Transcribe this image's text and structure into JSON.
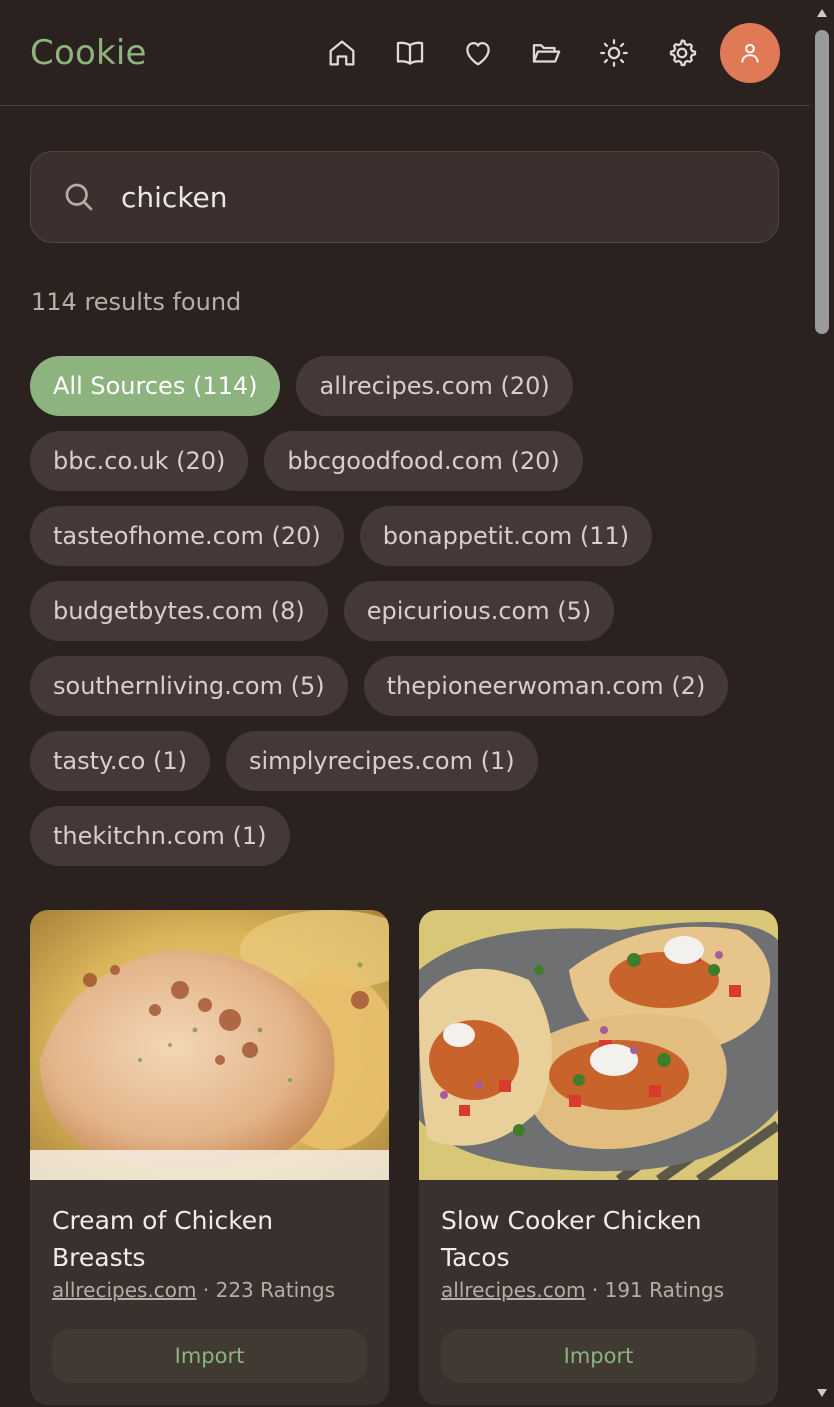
{
  "app": {
    "brand": "Cookie"
  },
  "nav": {
    "items": [
      {
        "icon": "home-icon"
      },
      {
        "icon": "book-icon"
      },
      {
        "icon": "heart-icon"
      },
      {
        "icon": "folder-open-icon"
      },
      {
        "icon": "sun-icon"
      },
      {
        "icon": "gear-icon"
      }
    ],
    "avatar_icon": "user-icon",
    "avatar_color": "#e07a56"
  },
  "search": {
    "value": "chicken"
  },
  "results_text": "114 results found",
  "sources": [
    {
      "label": "All Sources (114)",
      "active": true
    },
    {
      "label": "allrecipes.com (20)"
    },
    {
      "label": "bbc.co.uk (20)"
    },
    {
      "label": "bbcgoodfood.com (20)"
    },
    {
      "label": "tasteofhome.com (20)"
    },
    {
      "label": "bonappetit.com (11)"
    },
    {
      "label": "budgetbytes.com (8)"
    },
    {
      "label": "epicurious.com (5)"
    },
    {
      "label": "southernliving.com (5)"
    },
    {
      "label": "thepioneerwoman.com (2)"
    },
    {
      "label": "tasty.co (1)"
    },
    {
      "label": "simplyrecipes.com (1)"
    },
    {
      "label": "thekitchn.com (1)"
    }
  ],
  "recipes": [
    {
      "title": "Cream of Chicken Breasts",
      "source": "allrecipes.com",
      "ratings": "223 Ratings",
      "button": "Import"
    },
    {
      "title": "Slow Cooker Chicken Tacos",
      "source": "allrecipes.com",
      "ratings": "191 Ratings",
      "button": "Import"
    }
  ],
  "colors": {
    "background": "#2b2220",
    "accent": "#8db37e",
    "chip": "#443936",
    "card": "#3a302d"
  }
}
